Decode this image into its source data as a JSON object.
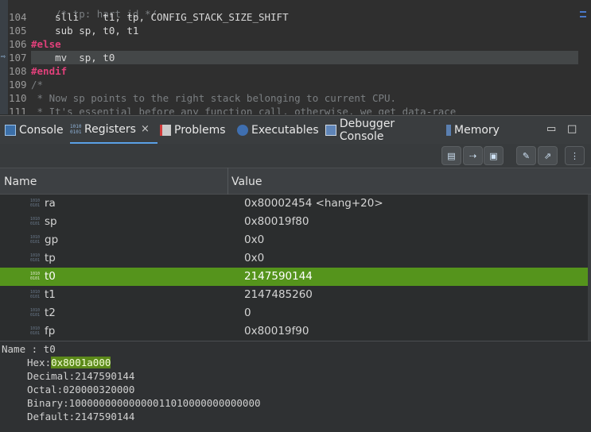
{
  "editor": {
    "lines": [
      {
        "num": "104",
        "text": "    slli    t1, tp, CONFIG_STACK_SIZE_SHIFT",
        "kind": "code"
      },
      {
        "num": "105",
        "text": "    sub sp, t0, t1",
        "kind": "code"
      },
      {
        "num": "106",
        "text": "#else",
        "kind": "pre"
      },
      {
        "num": "107",
        "text": "    mv  sp, t0",
        "kind": "code"
      },
      {
        "num": "108",
        "text": "#endif",
        "kind": "pre"
      },
      {
        "num": "109",
        "text": "/*",
        "kind": "comment"
      },
      {
        "num": "110",
        "text": " * Now sp points to the right stack belonging to current CPU.",
        "kind": "comment"
      },
      {
        "num": "111",
        "text": " * It's essential before any function call, otherwise, we get data-race",
        "kind": "comment"
      }
    ],
    "top_fragment": "    /* tp: hart id */",
    "highlighted_line": "107"
  },
  "tabs": [
    {
      "label": "Console",
      "icon": "console-icon",
      "active": false
    },
    {
      "label": "Registers",
      "icon": "registers-icon",
      "active": true
    },
    {
      "label": "Problems",
      "icon": "problems-icon",
      "active": false
    },
    {
      "label": "Executables",
      "icon": "executables-icon",
      "active": false
    },
    {
      "label": "Debugger Console",
      "icon": "debugger-console-icon",
      "active": false
    },
    {
      "label": "Memory",
      "icon": "memory-icon",
      "active": false
    }
  ],
  "window": {
    "minimize": "▭",
    "maximize": "□",
    "tab_close": "×"
  },
  "table": {
    "col_name": "Name",
    "col_value": "Value",
    "rows": [
      {
        "name": "ra",
        "value": "0x80002454 <hang+20>",
        "selected": false
      },
      {
        "name": "sp",
        "value": "0x80019f80",
        "selected": false
      },
      {
        "name": "gp",
        "value": "0x0",
        "selected": false
      },
      {
        "name": "tp",
        "value": "0x0",
        "selected": false
      },
      {
        "name": "t0",
        "value": "2147590144",
        "selected": true
      },
      {
        "name": "t1",
        "value": "2147485260",
        "selected": false
      },
      {
        "name": "t2",
        "value": "0",
        "selected": false
      },
      {
        "name": "fp",
        "value": "0x80019f90",
        "selected": false
      }
    ]
  },
  "details": {
    "name_line": "Name : t0",
    "hex_label": "Hex:",
    "hex_value": "0x8001a000",
    "decimal": "Decimal:2147590144",
    "octal": "Octal:020000320000",
    "binary": "Binary:10000000000000011010000000000000",
    "default": "Default:2147590144"
  },
  "colors": {
    "selection_green": "#55941c",
    "preprocessor_pink": "#e0407a",
    "tab_underline_blue": "#5aa0e6"
  }
}
